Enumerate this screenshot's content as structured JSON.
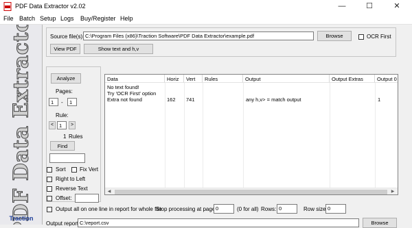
{
  "window": {
    "title": "PDF Data Extractor v2.02",
    "minimize": "—",
    "maximize": "☐",
    "close": "✕"
  },
  "menu": [
    "File",
    "Batch",
    "Setup",
    "Logs",
    "Buy/Register",
    "Help"
  ],
  "sidebar": {
    "title": "PDF Data Extractor 2",
    "brand": "Traction"
  },
  "source": {
    "label": "Source file(s):",
    "value": "C:\\Program Files (x86)\\Traction Software\\PDF Data Extractor\\example.pdf",
    "browse": "Browse",
    "ocr_first": "OCR First",
    "view_pdf": "View PDF",
    "show_text": "Show text and h,v"
  },
  "controls": {
    "analyze": "Analyze",
    "pages_label": "Pages:",
    "page_from": "1",
    "page_sep": "-",
    "page_to": "1",
    "rule_label": "Rule:",
    "rule_value": "1",
    "rule_prev": "<",
    "rule_next": ">",
    "rules_count": "1",
    "rules_label": "Rules",
    "find": "Find",
    "find_value": "",
    "sort": "Sort",
    "fix_vert": "Fix Vert",
    "right_to_left": "Right to Left",
    "reverse_text": "Reverse Text",
    "offset": "Offset:"
  },
  "table": {
    "columns": [
      "Data",
      "Horiz",
      "Vert",
      "Rules",
      "Output",
      "Output Extras",
      "Output 0"
    ],
    "rows": [
      [
        "No text found!",
        "",
        "",
        "",
        "",
        "",
        ""
      ],
      [
        "Try 'OCR First' option",
        "",
        "",
        "",
        "",
        "",
        ""
      ],
      [
        "Extra not found",
        "162",
        "741",
        "",
        "any h,v> = match output",
        "",
        "1"
      ]
    ],
    "scroll_left": "◀",
    "scroll_right": "▶"
  },
  "bottom": {
    "output_all": "Output all on one line in report for whole file",
    "stop_label": "Stop processing at page:",
    "stop_value": "0",
    "for_all": "(0 for all)",
    "rows_label": "Rows:",
    "rows_value": "0",
    "row_size_label": "Row size:",
    "row_size_value": "0",
    "output_report_label": "Output report:",
    "output_report_value": "C:\\report.csv",
    "browse": "Browse"
  }
}
